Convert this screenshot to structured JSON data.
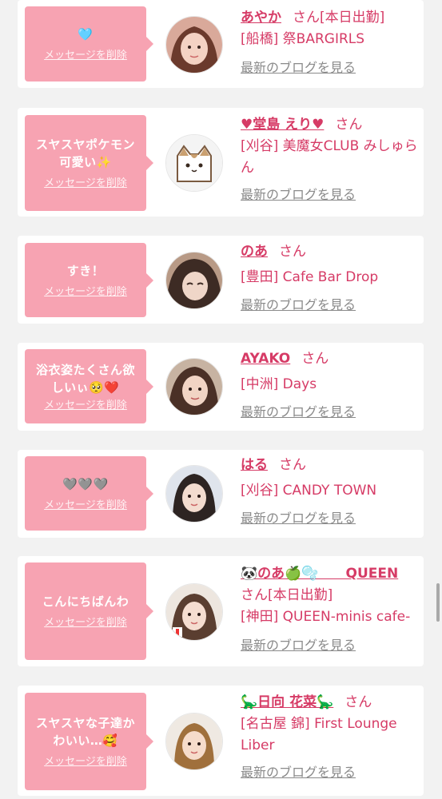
{
  "colors": {
    "page_bg": "#f2f2f2",
    "card_bg": "#ffffff",
    "bubble_bg": "#f7a3b2",
    "name_color": "#d63b66",
    "blog_link_color": "#8a8a8a"
  },
  "delete_label": "メッセージを削除",
  "honorific": "さん",
  "blog_label": "最新のブログを見る",
  "cards": [
    {
      "message": "🩵",
      "name": "あやか",
      "status": "[本日出勤]",
      "shop": "[船橋] 祭BARGIRLS",
      "avatar_icon": "avatar-photo-icon"
    },
    {
      "message": "スヤスヤポケモン可愛い✨",
      "name": "♥堂島 えり♥",
      "status": "",
      "shop": "[刈谷] 美魔女CLUB みしゅらん",
      "avatar_icon": "cat-illustration-icon"
    },
    {
      "message": "すき！",
      "name": "のあ",
      "status": "",
      "shop": "[豊田] Cafe Bar Drop",
      "avatar_icon": "avatar-photo-icon"
    },
    {
      "message": "浴衣姿たくさん欲しいぃ🥺❤️",
      "name": "AYAKO",
      "status": "",
      "shop": "[中洲] Days",
      "avatar_icon": "avatar-photo-icon"
    },
    {
      "message": "🩶🩶🩶",
      "name": "はる",
      "status": "",
      "shop": "[刈谷] CANDY TOWN",
      "avatar_icon": "avatar-photo-icon"
    },
    {
      "message": "こんにちばんわ",
      "name": "🐼のあ🍏🫧　　QUEEN",
      "status": "[本日出勤]",
      "shop": "[神田] QUEEN-minis cafe-",
      "avatar_icon": "avatar-photo-icon"
    },
    {
      "message": "スヤスヤな子達かわいい…🥰",
      "name": "🦕日向 花菜🦕",
      "status": "",
      "shop": "[名古屋 錦] First Lounge Liber",
      "avatar_icon": "avatar-photo-icon"
    }
  ]
}
